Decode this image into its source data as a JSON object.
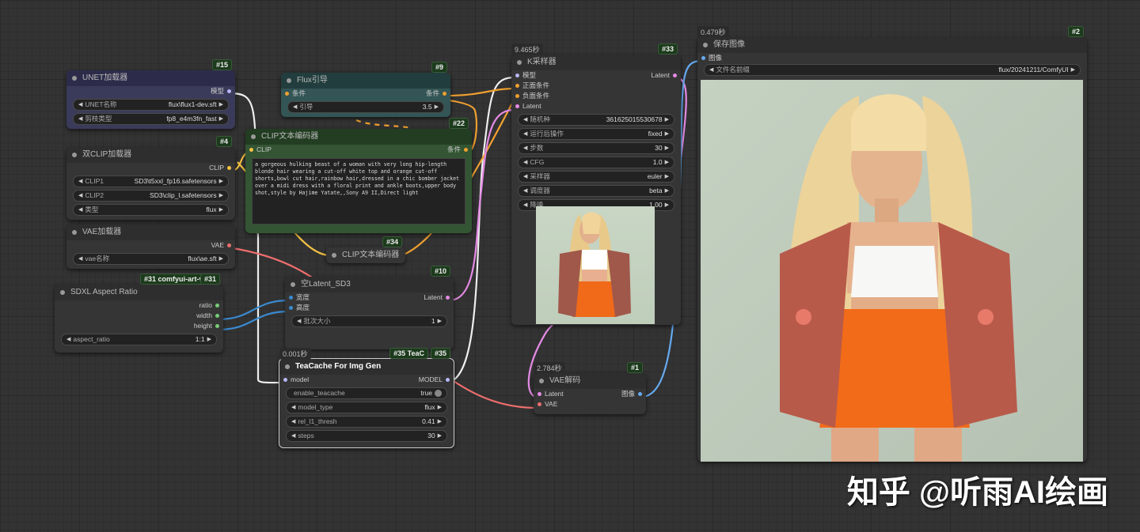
{
  "watermark": "知乎 @听雨AI绘画",
  "unet": {
    "badge": "#15",
    "title": "UNET加载器",
    "out": "模型",
    "w1l": "UNET名称",
    "w1v": "flux\\flux1-dev.sft",
    "w2l": "剪枝类型",
    "w2v": "fp8_e4m3fn_fast"
  },
  "dualclip": {
    "badge": "#4",
    "title": "双CLIP加载器",
    "out": "CLIP",
    "w1l": "CLIP1",
    "w1v": "SD3\\t5xxl_fp16.safetensors",
    "w2l": "CLIP2",
    "w2v": "SD3\\clip_l.safetensors",
    "w3l": "类型",
    "w3v": "flux"
  },
  "vae": {
    "title": "VAE加载器",
    "out": "VAE",
    "w1l": "vae名称",
    "w1v": "flux\\ae.sft"
  },
  "sdxl": {
    "badge": "#31 comfyui-art-ve",
    "badge2": "#31",
    "title": "SDXL Aspect Ratio",
    "o1": "ratio",
    "o2": "width",
    "o3": "height",
    "w1l": "aspect_ratio",
    "w1v": "1:1"
  },
  "flux": {
    "badge": "#9",
    "title": "Flux引导",
    "in": "条件",
    "out": "条件",
    "w1l": "引导",
    "w1v": "3.5"
  },
  "clip": {
    "badge": "#22",
    "title": "CLIP文本编码器",
    "in": "CLIP",
    "out": "条件",
    "text": "a gorgeous hulking beast of a woman with very long hip-length blonde hair wearing a cut-off white top and orange cut-off shorts,bowl cut hair,rainbow hair,dressed in a chic bomber jacket over a midi dress with a floral print and ankle boots,upper body shot,style by Hajime Yatate,,Sony A9 II,Direct light"
  },
  "clip2": {
    "badge": "#34",
    "title": "CLIP文本编码器"
  },
  "latent": {
    "badge": "#10",
    "title": "空Latent_SD3",
    "i1": "宽度",
    "i2": "高度",
    "out": "Latent",
    "w1l": "批次大小",
    "w1v": "1"
  },
  "tea": {
    "timer": "0.001秒",
    "badge": "#35 TeaC",
    "badge2": "#35",
    "title": "TeaCache For Img Gen",
    "in": "model",
    "out": "MODEL",
    "w1l": "enable_teacache",
    "w1v": "true",
    "w2l": "model_type",
    "w2v": "flux",
    "w3l": "rel_l1_thresh",
    "w3v": "0.41",
    "w4l": "steps",
    "w4v": "30"
  },
  "ks": {
    "timer": "9.465秒",
    "badge": "#33",
    "title": "K采样器",
    "i1": "模型",
    "i2": "正面条件",
    "i3": "负面条件",
    "i4": "Latent",
    "out": "Latent",
    "w1l": "随机种",
    "w1v": "361625015530678",
    "w2l": "运行后操作",
    "w2v": "fixed",
    "w3l": "步数",
    "w3v": "30",
    "w4l": "CFG",
    "w4v": "1.0",
    "w5l": "采样器",
    "w5v": "euler",
    "w6l": "调度器",
    "w6v": "beta",
    "w7l": "降噪",
    "w7v": "1.00"
  },
  "vaedec": {
    "timer": "2.784秒",
    "badge": "#1",
    "title": "VAE解码",
    "i1": "Latent",
    "i2": "VAE",
    "out": "图像"
  },
  "save": {
    "timer": "0.479秒",
    "badge": "#2",
    "title": "保存图像",
    "in": "图像",
    "w1l": "文件名前缀",
    "w1v": "flux/20241211/ComfyUI"
  }
}
